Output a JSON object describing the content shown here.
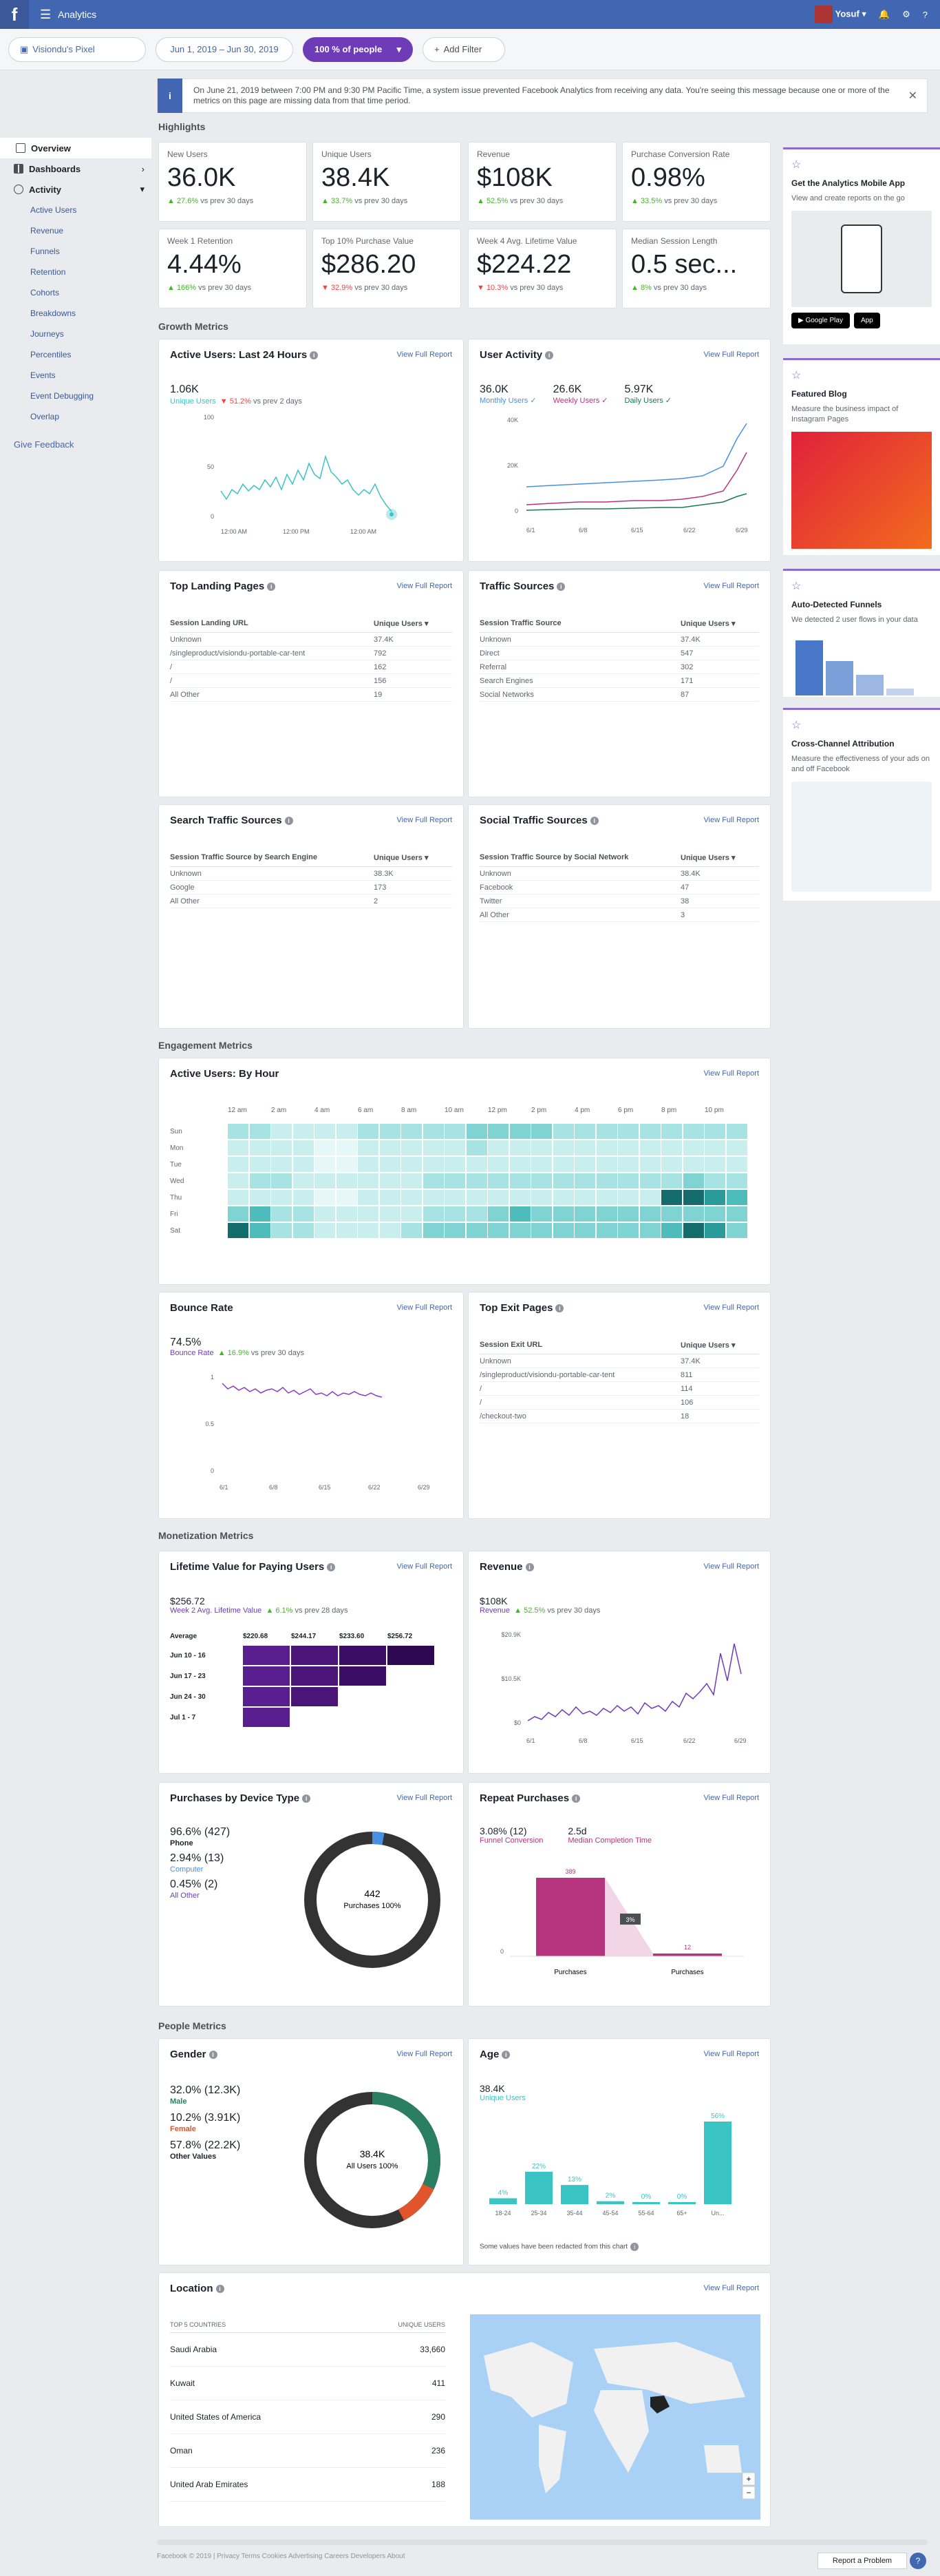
{
  "topbar": {
    "title": "Analytics",
    "user": "Yosuf"
  },
  "filters": {
    "pixel": "Visiondu's Pixel",
    "dates": "Jun 1, 2019 – Jun 30, 2019",
    "people": "100 % of people",
    "add": "Add Filter"
  },
  "sidebar": {
    "overview": "Overview",
    "dashboards": "Dashboards",
    "activity": "Activity",
    "items": [
      "Active Users",
      "Revenue",
      "Funnels",
      "Retention",
      "Cohorts",
      "Breakdowns",
      "Journeys",
      "Percentiles",
      "Events",
      "Event Debugging",
      "Overlap"
    ],
    "feedback": "Give Feedback"
  },
  "notice": "On June 21, 2019 between 7:00 PM and 9:30 PM Pacific Time, a system issue prevented Facebook Analytics from receiving any data. You're seeing this message because one or more of the metrics on this page are missing data from that time period.",
  "sections": {
    "highlights": "Highlights",
    "growth": "Growth Metrics",
    "engagement": "Engagement Metrics",
    "monetization": "Monetization Metrics",
    "people": "People Metrics"
  },
  "view_full": "View Full Report",
  "kpis": [
    {
      "label": "New Users",
      "value": "36.0K",
      "change": "▲ 27.6%",
      "rest": " vs prev 30 days",
      "dir": "up"
    },
    {
      "label": "Unique Users",
      "value": "38.4K",
      "change": "▲ 33.7%",
      "rest": " vs prev 30 days",
      "dir": "up"
    },
    {
      "label": "Revenue",
      "value": "$108K",
      "change": "▲ 52.5%",
      "rest": " vs prev 30 days",
      "dir": "up"
    },
    {
      "label": "Purchase Conversion Rate",
      "value": "0.98%",
      "change": "▲ 33.5%",
      "rest": " vs prev 30 days",
      "dir": "up"
    },
    {
      "label": "Week 1 Retention",
      "value": "4.44%",
      "change": "▲ 166%",
      "rest": " vs prev 30 days",
      "dir": "up"
    },
    {
      "label": "Top 10% Purchase Value",
      "value": "$286.20",
      "change": "▼ 32.9%",
      "rest": " vs prev 30 days",
      "dir": "down"
    },
    {
      "label": "Week 4 Avg. Lifetime Value",
      "value": "$224.22",
      "change": "▼ 10.3%",
      "rest": " vs prev 30 days",
      "dir": "down"
    },
    {
      "label": "Median Session Length",
      "value": "0.5 sec...",
      "change": "▲ 8%",
      "rest": " vs prev 30 days",
      "dir": "up"
    }
  ],
  "active24": {
    "title": "Active Users: Last 24 Hours",
    "value": "1.06K",
    "label": "Unique Users",
    "change": "▼ 51.2%",
    "rest": " vs prev 2 days",
    "yticks": [
      "100",
      "50",
      "0"
    ],
    "xticks": [
      "12:00 AM",
      "12:00 PM",
      "12:00 AM"
    ]
  },
  "userActivity": {
    "title": "User Activity",
    "m": {
      "v": "36.0K",
      "l": "Monthly Users ✓"
    },
    "w": {
      "v": "26.6K",
      "l": "Weekly Users ✓"
    },
    "d": {
      "v": "5.97K",
      "l": "Daily Users ✓"
    },
    "yticks": [
      "40K",
      "20K",
      "0"
    ],
    "xticks": [
      "6/1",
      "6/8",
      "6/15",
      "6/22",
      "6/29"
    ]
  },
  "landing": {
    "title": "Top Landing Pages",
    "h1": "Session Landing URL",
    "h2": "Unique Users ▾",
    "rows": [
      [
        "Unknown",
        "37.4K"
      ],
      [
        "/singleproduct/visiondu-portable-car-tent",
        "792"
      ],
      [
        "/",
        "162"
      ],
      [
        "/",
        "156"
      ],
      [
        "All Other",
        "19"
      ]
    ]
  },
  "traffic": {
    "title": "Traffic Sources",
    "h1": "Session Traffic Source",
    "h2": "Unique Users ▾",
    "rows": [
      [
        "Unknown",
        "37.4K"
      ],
      [
        "Direct",
        "547"
      ],
      [
        "Referral",
        "302"
      ],
      [
        "Search Engines",
        "171"
      ],
      [
        "Social Networks",
        "87"
      ]
    ]
  },
  "search": {
    "title": "Search Traffic Sources",
    "h1": "Session Traffic Source by Search Engine",
    "h2": "Unique Users ▾",
    "rows": [
      [
        "Unknown",
        "38.3K"
      ],
      [
        "Google",
        "173"
      ],
      [
        "All Other",
        "2"
      ]
    ]
  },
  "social": {
    "title": "Social Traffic Sources",
    "h1": "Session Traffic Source by Social Network",
    "h2": "Unique Users ▾",
    "rows": [
      [
        "Unknown",
        "38.4K"
      ],
      [
        "Facebook",
        "47"
      ],
      [
        "Twitter",
        "38"
      ],
      [
        "All Other",
        "3"
      ]
    ]
  },
  "heatmap": {
    "title": "Active Users: By Hour",
    "days": [
      "Sun",
      "Mon",
      "Tue",
      "Wed",
      "Thu",
      "Fri",
      "Sat"
    ],
    "hours": [
      "12 am",
      "2 am",
      "4 am",
      "6 am",
      "8 am",
      "10 am",
      "12 pm",
      "2 pm",
      "4 pm",
      "6 pm",
      "8 pm",
      "10 pm"
    ]
  },
  "bounce": {
    "title": "Bounce Rate",
    "value": "74.5%",
    "label": "Bounce Rate",
    "change": "▲ 16.9%",
    "rest": " vs prev 30 days",
    "yticks": [
      "1",
      "0.5",
      "0"
    ],
    "xticks": [
      "6/1",
      "6/8",
      "6/15",
      "6/22",
      "6/29"
    ]
  },
  "exit": {
    "title": "Top Exit Pages",
    "h1": "Session Exit URL",
    "h2": "Unique Users ▾",
    "rows": [
      [
        "Unknown",
        "37.4K"
      ],
      [
        "/singleproduct/visiondu-portable-car-tent",
        "811"
      ],
      [
        "/",
        "114"
      ],
      [
        "/",
        "106"
      ],
      [
        "/checkout-two",
        "18"
      ]
    ]
  },
  "ltv": {
    "title": "Lifetime Value for Paying Users",
    "value": "$256.72",
    "label": "Week 2 Avg. Lifetime Value",
    "change": "▲ 6.1%",
    "rest": " vs prev 28 days",
    "avg": "Average",
    "cols": [
      "$220.68",
      "$244.17",
      "$233.60",
      "$256.72"
    ],
    "rows": [
      "Jun 10 - 16",
      "Jun 17 - 23",
      "Jun 24 - 30",
      "Jul 1 - 7"
    ]
  },
  "revenue": {
    "title": "Revenue",
    "value": "$108K",
    "label": "Revenue",
    "change": "▲ 52.5%",
    "rest": " vs prev 30 days",
    "yticks": [
      "$20.9K",
      "$10.5K",
      "$0"
    ],
    "xticks": [
      "6/1",
      "6/8",
      "6/15",
      "6/22",
      "6/29"
    ]
  },
  "device": {
    "title": "Purchases by Device Type",
    "items": [
      {
        "v": "96.6% (427)",
        "l": "Phone"
      },
      {
        "v": "2.94% (13)",
        "l": "Computer"
      },
      {
        "v": "0.45% (2)",
        "l": "All Other"
      }
    ],
    "center": "442",
    "center2": "Purchases 100%"
  },
  "repeat": {
    "title": "Repeat Purchases",
    "v1": "3.08% (12)",
    "l1": "Funnel Conversion",
    "v2": "2.5d",
    "l2": "Median Completion Time",
    "b1": "389",
    "b2": "12",
    "pct": "3%",
    "x1": "Purchases",
    "x2": "Purchases",
    "y0": "0"
  },
  "gender": {
    "title": "Gender",
    "items": [
      {
        "v": "32.0% (12.3K)",
        "l": "Male"
      },
      {
        "v": "10.2% (3.91K)",
        "l": "Female"
      },
      {
        "v": "57.8% (22.2K)",
        "l": "Other Values"
      }
    ],
    "center": "38.4K",
    "center2": "All Users 100%"
  },
  "age": {
    "title": "Age",
    "value": "38.4K",
    "label": "Unique Users",
    "note": "Some values have been redacted from this chart",
    "bars": [
      {
        "c": "18-24",
        "p": "4%",
        "v": 4
      },
      {
        "c": "25-34",
        "p": "22%",
        "v": 22
      },
      {
        "c": "35-44",
        "p": "13%",
        "v": 13
      },
      {
        "c": "45-54",
        "p": "2%",
        "v": 2
      },
      {
        "c": "55-64",
        "p": "0%",
        "v": 0
      },
      {
        "c": "65+",
        "p": "0%",
        "v": 0
      },
      {
        "c": "Un...",
        "p": "56%",
        "v": 56
      }
    ]
  },
  "location": {
    "title": "Location",
    "h1": "TOP 5 COUNTRIES",
    "h2": "UNIQUE USERS",
    "rows": [
      [
        "Saudi Arabia",
        "33,660"
      ],
      [
        "Kuwait",
        "411"
      ],
      [
        "United States of America",
        "290"
      ],
      [
        "Oman",
        "236"
      ],
      [
        "United Arab Emirates",
        "188"
      ]
    ]
  },
  "right": [
    {
      "title": "Get the Analytics Mobile App",
      "desc": "View and create reports on the go"
    },
    {
      "title": "Featured Blog",
      "desc": "Measure the business impact of Instagram Pages"
    },
    {
      "title": "Auto-Detected Funnels",
      "desc": "We detected 2 user flows in your data"
    },
    {
      "title": "Cross-Channel Attribution",
      "desc": "Measure the effectiveness of your ads on and off Facebook"
    }
  ],
  "footer": "Facebook © 2019  |  Privacy   Terms   Cookies   Advertising   Careers   Developers   About",
  "report": "Report a Problem",
  "colors": {
    "blue": "#4267b2",
    "purple": "#6f3cb8",
    "teal": "#3ac4c4",
    "pink": "#b5347d",
    "green": "#42b72a"
  }
}
